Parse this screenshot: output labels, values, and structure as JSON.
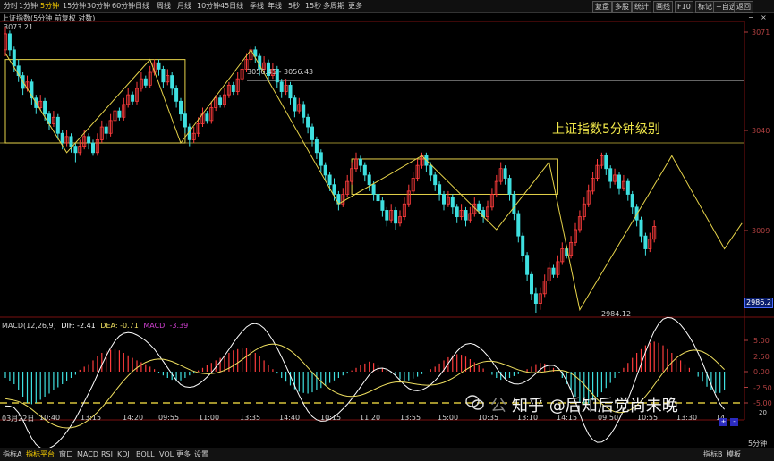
{
  "toolbar": {
    "left_items": [
      "分时",
      "1分钟",
      "5分钟",
      "15分钟",
      "30分钟",
      "60分钟",
      "日线",
      "周线",
      "月线",
      "10分钟",
      "45日线",
      "季线",
      "年线",
      "5秒",
      "15秒",
      "多周期",
      "更多"
    ],
    "active_index": 2,
    "right_items": [
      "复盘",
      "多股",
      "统计",
      "画线",
      "F10",
      "标记",
      "+自选",
      "返回"
    ],
    "top_right_icons": [
      "minimize-icon",
      "close-icon"
    ]
  },
  "subtitle": "上证指数(5分钟 前复权 对数)",
  "price_labels": {
    "high": "3073.21",
    "range": "3056.45 - 3056.43",
    "low": "2984.12",
    "current": "2986.2"
  },
  "y_axis": [
    "3071",
    "3040",
    "3009"
  ],
  "annotation": "上证指数5分钟级别",
  "macd": {
    "name": "MACD(12,26,9)",
    "dif": "DIF: -2.41",
    "dea": "DEA: -0.71",
    "macd": "MACD: -3.39",
    "colors": {
      "dif": "#ffffff",
      "dea": "#f0e060",
      "macd": "#d040d0"
    }
  },
  "macd_axis": [
    "5.00",
    "2.50",
    "0.00",
    "-2.50",
    "-5.00"
  ],
  "x_axis": [
    "03月22日",
    "10:40",
    "13:15",
    "14:20",
    "09:55",
    "11:00",
    "13:35",
    "14:40",
    "10:15",
    "11:20",
    "13:55",
    "15:00",
    "10:35",
    "13:10",
    "14:15",
    "09:50",
    "10:55",
    "13:30",
    "14"
  ],
  "x_axis_right": "20",
  "bottom_tabs": [
    "指标A",
    "指标平台",
    "窗口",
    "MACD",
    "RSI",
    "KDJ",
    "BOLL",
    "VOL",
    "更多",
    "设置"
  ],
  "bottom_active_index": 1,
  "bottom_right": [
    "指标B",
    "模板",
    "5分钟"
  ],
  "watermark": "知乎 @后知后觉尚未晚",
  "watermark_prefix": "公",
  "colors": {
    "up": "#ff3c3c",
    "down": "#3fe0e0",
    "box": "#e6d34a",
    "accent": "#ffd400"
  },
  "chart_data": {
    "type": "candlestick",
    "candles": [
      {
        "o": 3066,
        "c": 3071,
        "h": 3073.2,
        "l": 3064
      },
      {
        "o": 3071,
        "c": 3066,
        "h": 3072,
        "l": 3064
      },
      {
        "o": 3066,
        "c": 3061,
        "h": 3067,
        "l": 3059
      },
      {
        "o": 3061,
        "c": 3058,
        "h": 3063,
        "l": 3056
      },
      {
        "o": 3058,
        "c": 3054,
        "h": 3059,
        "l": 3052
      },
      {
        "o": 3054,
        "c": 3056,
        "h": 3058,
        "l": 3053
      },
      {
        "o": 3056,
        "c": 3051,
        "h": 3057,
        "l": 3049
      },
      {
        "o": 3051,
        "c": 3048,
        "h": 3052,
        "l": 3046
      },
      {
        "o": 3048,
        "c": 3050,
        "h": 3052,
        "l": 3047
      },
      {
        "o": 3050,
        "c": 3046,
        "h": 3051,
        "l": 3044
      },
      {
        "o": 3046,
        "c": 3043,
        "h": 3047,
        "l": 3041
      },
      {
        "o": 3043,
        "c": 3045,
        "h": 3047,
        "l": 3042
      },
      {
        "o": 3045,
        "c": 3040,
        "h": 3046,
        "l": 3038
      },
      {
        "o": 3040,
        "c": 3037,
        "h": 3041,
        "l": 3035
      },
      {
        "o": 3037,
        "c": 3039,
        "h": 3041,
        "l": 3036
      },
      {
        "o": 3039,
        "c": 3036,
        "h": 3040,
        "l": 3034
      },
      {
        "o": 3036,
        "c": 3034,
        "h": 3037,
        "l": 3031
      },
      {
        "o": 3034,
        "c": 3036,
        "h": 3038,
        "l": 3033
      },
      {
        "o": 3036,
        "c": 3039,
        "h": 3041,
        "l": 3035
      },
      {
        "o": 3039,
        "c": 3037,
        "h": 3040,
        "l": 3035
      },
      {
        "o": 3037,
        "c": 3034,
        "h": 3038,
        "l": 3033
      },
      {
        "o": 3034,
        "c": 3038,
        "h": 3040,
        "l": 3033
      },
      {
        "o": 3038,
        "c": 3042,
        "h": 3044,
        "l": 3037
      },
      {
        "o": 3042,
        "c": 3040,
        "h": 3043,
        "l": 3038
      },
      {
        "o": 3040,
        "c": 3044,
        "h": 3046,
        "l": 3039
      },
      {
        "o": 3044,
        "c": 3047,
        "h": 3049,
        "l": 3043
      },
      {
        "o": 3047,
        "c": 3045,
        "h": 3048,
        "l": 3044
      },
      {
        "o": 3045,
        "c": 3049,
        "h": 3051,
        "l": 3044
      },
      {
        "o": 3049,
        "c": 3052,
        "h": 3054,
        "l": 3048
      },
      {
        "o": 3052,
        "c": 3050,
        "h": 3053,
        "l": 3049
      },
      {
        "o": 3050,
        "c": 3054,
        "h": 3056,
        "l": 3049
      },
      {
        "o": 3054,
        "c": 3057,
        "h": 3059,
        "l": 3053
      },
      {
        "o": 3057,
        "c": 3055,
        "h": 3058,
        "l": 3054
      },
      {
        "o": 3055,
        "c": 3059,
        "h": 3061,
        "l": 3054
      },
      {
        "o": 3059,
        "c": 3062,
        "h": 3063,
        "l": 3058
      },
      {
        "o": 3062,
        "c": 3060,
        "h": 3063,
        "l": 3058
      },
      {
        "o": 3060,
        "c": 3056,
        "h": 3061,
        "l": 3054
      },
      {
        "o": 3056,
        "c": 3058,
        "h": 3060,
        "l": 3055
      },
      {
        "o": 3058,
        "c": 3054,
        "h": 3059,
        "l": 3052
      },
      {
        "o": 3054,
        "c": 3050,
        "h": 3055,
        "l": 3048
      },
      {
        "o": 3050,
        "c": 3046,
        "h": 3051,
        "l": 3044
      },
      {
        "o": 3046,
        "c": 3042,
        "h": 3047,
        "l": 3040
      },
      {
        "o": 3042,
        "c": 3038,
        "h": 3043,
        "l": 3036
      },
      {
        "o": 3038,
        "c": 3040,
        "h": 3042,
        "l": 3037
      },
      {
        "o": 3040,
        "c": 3043,
        "h": 3045,
        "l": 3039
      },
      {
        "o": 3043,
        "c": 3046,
        "h": 3048,
        "l": 3042
      },
      {
        "o": 3046,
        "c": 3044,
        "h": 3047,
        "l": 3043
      },
      {
        "o": 3044,
        "c": 3048,
        "h": 3050,
        "l": 3043
      },
      {
        "o": 3048,
        "c": 3051,
        "h": 3052,
        "l": 3047
      },
      {
        "o": 3051,
        "c": 3049,
        "h": 3052,
        "l": 3048
      },
      {
        "o": 3049,
        "c": 3052,
        "h": 3054,
        "l": 3048
      },
      {
        "o": 3052,
        "c": 3055,
        "h": 3056,
        "l": 3051
      },
      {
        "o": 3055,
        "c": 3053,
        "h": 3056,
        "l": 3052
      },
      {
        "o": 3053,
        "c": 3057,
        "h": 3059,
        "l": 3052
      },
      {
        "o": 3057,
        "c": 3060,
        "h": 3062,
        "l": 3056
      },
      {
        "o": 3060,
        "c": 3063,
        "h": 3065,
        "l": 3059
      },
      {
        "o": 3063,
        "c": 3066,
        "h": 3067,
        "l": 3062
      },
      {
        "o": 3066,
        "c": 3064,
        "h": 3067,
        "l": 3062
      },
      {
        "o": 3064,
        "c": 3060,
        "h": 3065,
        "l": 3058
      },
      {
        "o": 3060,
        "c": 3062,
        "h": 3064,
        "l": 3059
      },
      {
        "o": 3062,
        "c": 3058,
        "h": 3063,
        "l": 3056
      },
      {
        "o": 3058,
        "c": 3060,
        "h": 3062,
        "l": 3057
      },
      {
        "o": 3060,
        "c": 3056,
        "h": 3061,
        "l": 3054
      },
      {
        "o": 3056,
        "c": 3053,
        "h": 3057,
        "l": 3051
      },
      {
        "o": 3053,
        "c": 3055,
        "h": 3057,
        "l": 3052
      },
      {
        "o": 3055,
        "c": 3051,
        "h": 3056,
        "l": 3049
      },
      {
        "o": 3051,
        "c": 3047,
        "h": 3052,
        "l": 3045
      },
      {
        "o": 3047,
        "c": 3049,
        "h": 3051,
        "l": 3046
      },
      {
        "o": 3049,
        "c": 3045,
        "h": 3050,
        "l": 3043
      },
      {
        "o": 3045,
        "c": 3042,
        "h": 3046,
        "l": 3040
      },
      {
        "o": 3042,
        "c": 3038,
        "h": 3043,
        "l": 3036
      },
      {
        "o": 3038,
        "c": 3034,
        "h": 3039,
        "l": 3032
      },
      {
        "o": 3034,
        "c": 3030,
        "h": 3035,
        "l": 3028
      },
      {
        "o": 3030,
        "c": 3027,
        "h": 3031,
        "l": 3025
      },
      {
        "o": 3027,
        "c": 3024,
        "h": 3028,
        "l": 3022
      },
      {
        "o": 3024,
        "c": 3021,
        "h": 3026,
        "l": 3019
      },
      {
        "o": 3021,
        "c": 3018,
        "h": 3022,
        "l": 3016
      },
      {
        "o": 3018,
        "c": 3021,
        "h": 3023,
        "l": 3017
      },
      {
        "o": 3021,
        "c": 3025,
        "h": 3027,
        "l": 3020
      },
      {
        "o": 3025,
        "c": 3029,
        "h": 3031,
        "l": 3024
      },
      {
        "o": 3029,
        "c": 3032,
        "h": 3034,
        "l": 3028
      },
      {
        "o": 3032,
        "c": 3030,
        "h": 3033,
        "l": 3028
      },
      {
        "o": 3030,
        "c": 3027,
        "h": 3031,
        "l": 3025
      },
      {
        "o": 3027,
        "c": 3024,
        "h": 3028,
        "l": 3022
      },
      {
        "o": 3024,
        "c": 3021,
        "h": 3025,
        "l": 3019
      },
      {
        "o": 3021,
        "c": 3019,
        "h": 3022,
        "l": 3017
      },
      {
        "o": 3019,
        "c": 3016,
        "h": 3020,
        "l": 3014
      },
      {
        "o": 3016,
        "c": 3013,
        "h": 3017,
        "l": 3011
      },
      {
        "o": 3013,
        "c": 3016,
        "h": 3018,
        "l": 3012
      },
      {
        "o": 3016,
        "c": 3012,
        "h": 3017,
        "l": 3010
      },
      {
        "o": 3012,
        "c": 3014,
        "h": 3016,
        "l": 3011
      },
      {
        "o": 3014,
        "c": 3018,
        "h": 3020,
        "l": 3013
      },
      {
        "o": 3018,
        "c": 3022,
        "h": 3024,
        "l": 3017
      },
      {
        "o": 3022,
        "c": 3026,
        "h": 3028,
        "l": 3021
      },
      {
        "o": 3026,
        "c": 3030,
        "h": 3032,
        "l": 3025
      },
      {
        "o": 3030,
        "c": 3033,
        "h": 3034,
        "l": 3029
      },
      {
        "o": 3033,
        "c": 3030,
        "h": 3034,
        "l": 3028
      },
      {
        "o": 3030,
        "c": 3027,
        "h": 3031,
        "l": 3025
      },
      {
        "o": 3027,
        "c": 3024,
        "h": 3028,
        "l": 3022
      },
      {
        "o": 3024,
        "c": 3021,
        "h": 3025,
        "l": 3019
      },
      {
        "o": 3021,
        "c": 3018,
        "h": 3022,
        "l": 3016
      },
      {
        "o": 3018,
        "c": 3020,
        "h": 3022,
        "l": 3017
      },
      {
        "o": 3020,
        "c": 3017,
        "h": 3021,
        "l": 3015
      },
      {
        "o": 3017,
        "c": 3014,
        "h": 3018,
        "l": 3012
      },
      {
        "o": 3014,
        "c": 3016,
        "h": 3018,
        "l": 3013
      },
      {
        "o": 3016,
        "c": 3013,
        "h": 3017,
        "l": 3011
      },
      {
        "o": 3013,
        "c": 3015,
        "h": 3017,
        "l": 3012
      },
      {
        "o": 3015,
        "c": 3018,
        "h": 3020,
        "l": 3014
      },
      {
        "o": 3018,
        "c": 3016,
        "h": 3019,
        "l": 3015
      },
      {
        "o": 3016,
        "c": 3014,
        "h": 3017,
        "l": 3012
      },
      {
        "o": 3014,
        "c": 3017,
        "h": 3019,
        "l": 3013
      },
      {
        "o": 3017,
        "c": 3021,
        "h": 3023,
        "l": 3016
      },
      {
        "o": 3021,
        "c": 3025,
        "h": 3027,
        "l": 3020
      },
      {
        "o": 3025,
        "c": 3029,
        "h": 3031,
        "l": 3024
      },
      {
        "o": 3029,
        "c": 3026,
        "h": 3030,
        "l": 3024
      },
      {
        "o": 3026,
        "c": 3021,
        "h": 3027,
        "l": 3019
      },
      {
        "o": 3021,
        "c": 3015,
        "h": 3022,
        "l": 3013
      },
      {
        "o": 3015,
        "c": 3008,
        "h": 3016,
        "l": 3006
      },
      {
        "o": 3008,
        "c": 3002,
        "h": 3009,
        "l": 3000
      },
      {
        "o": 3002,
        "c": 2996,
        "h": 3003,
        "l": 2994
      },
      {
        "o": 2996,
        "c": 2990,
        "h": 2997,
        "l": 2988
      },
      {
        "o": 2990,
        "c": 2987,
        "h": 2992,
        "l": 2984.1
      },
      {
        "o": 2987,
        "c": 2990,
        "h": 2992,
        "l": 2985
      },
      {
        "o": 2990,
        "c": 2994,
        "h": 2996,
        "l": 2989
      },
      {
        "o": 2994,
        "c": 2998,
        "h": 3000,
        "l": 2993
      },
      {
        "o": 2998,
        "c": 2996,
        "h": 2999,
        "l": 2995
      },
      {
        "o": 2996,
        "c": 3000,
        "h": 3002,
        "l": 2995
      },
      {
        "o": 3000,
        "c": 3004,
        "h": 3006,
        "l": 2999
      },
      {
        "o": 3004,
        "c": 3002,
        "h": 3005,
        "l": 3001
      },
      {
        "o": 3002,
        "c": 3006,
        "h": 3008,
        "l": 3001
      },
      {
        "o": 3006,
        "c": 3010,
        "h": 3012,
        "l": 3005
      },
      {
        "o": 3010,
        "c": 3014,
        "h": 3016,
        "l": 3009
      },
      {
        "o": 3014,
        "c": 3018,
        "h": 3020,
        "l": 3013
      },
      {
        "o": 3018,
        "c": 3022,
        "h": 3024,
        "l": 3017
      },
      {
        "o": 3022,
        "c": 3026,
        "h": 3028,
        "l": 3021
      },
      {
        "o": 3026,
        "c": 3030,
        "h": 3032,
        "l": 3025
      },
      {
        "o": 3030,
        "c": 3033,
        "h": 3034,
        "l": 3029
      },
      {
        "o": 3033,
        "c": 3029,
        "h": 3034,
        "l": 3027
      },
      {
        "o": 3029,
        "c": 3025,
        "h": 3030,
        "l": 3023
      },
      {
        "o": 3025,
        "c": 3027,
        "h": 3029,
        "l": 3024
      },
      {
        "o": 3027,
        "c": 3023,
        "h": 3028,
        "l": 3021
      },
      {
        "o": 3023,
        "c": 3025,
        "h": 3027,
        "l": 3022
      },
      {
        "o": 3025,
        "c": 3021,
        "h": 3026,
        "l": 3019
      },
      {
        "o": 3021,
        "c": 3017,
        "h": 3022,
        "l": 3015
      },
      {
        "o": 3017,
        "c": 3013,
        "h": 3018,
        "l": 3011
      },
      {
        "o": 3013,
        "c": 3008,
        "h": 3014,
        "l": 3006
      },
      {
        "o": 3008,
        "c": 3004,
        "h": 3009,
        "l": 3002
      },
      {
        "o": 3004,
        "c": 3007,
        "h": 3009,
        "l": 3003
      },
      {
        "o": 3007,
        "c": 3011,
        "h": 3013,
        "l": 3006
      }
    ],
    "zigzag": [
      [
        0,
        3065
      ],
      [
        14,
        3034
      ],
      [
        33,
        3063
      ],
      [
        40,
        3037
      ],
      [
        56,
        3066
      ],
      [
        76,
        3018
      ],
      [
        95,
        3033
      ],
      [
        112,
        3010
      ],
      [
        124,
        3031
      ],
      [
        131,
        2985
      ],
      [
        152,
        3033
      ],
      [
        164,
        3004
      ],
      [
        168,
        3012
      ]
    ],
    "boxes": [
      [
        0,
        41,
        3037,
        3063
      ],
      [
        79,
        126,
        3021,
        3032
      ]
    ],
    "hlines": [
      3056.4,
      3037
    ],
    "macd_hist": [
      -1,
      -1.5,
      -2,
      -3,
      -4,
      -5,
      -5.2,
      -5,
      -4.5,
      -4,
      -3.5,
      -3,
      -2.5,
      -2,
      -1.5,
      -1,
      -0.5,
      0.3,
      0.8,
      1.2,
      1.8,
      2.5,
      3,
      3.3,
      3.5,
      3.6,
      3.4,
      3,
      2.6,
      2.2,
      1.8,
      1.5,
      1.2,
      0.8,
      0.4,
      -0.2,
      -0.6,
      -1,
      -1.3,
      -1.6,
      -1.4,
      -1,
      -0.6,
      -0.3,
      0.2,
      0.6,
      1,
      1.4,
      1.8,
      2.2,
      2.6,
      3,
      3.4,
      3.6,
      3.7,
      3.8,
      3.5,
      3,
      2.5,
      1.8,
      1,
      0.4,
      -0.3,
      -1,
      -1.6,
      -2.2,
      -2.8,
      -3.2,
      -3.4,
      -3.5,
      -3.3,
      -3,
      -2.6,
      -2.2,
      -1.8,
      -1.4,
      -1,
      -0.6,
      -0.3,
      0.2,
      0.6,
      1,
      1.3,
      1.6,
      1.4,
      1,
      0.6,
      0.2,
      -0.3,
      -0.8,
      -1.2,
      -1.5,
      -1.4,
      -1.1,
      -0.8,
      -0.4,
      0,
      0.4,
      0.8,
      1.3,
      1.8,
      2.3,
      2.6,
      2.8,
      2.7,
      2.4,
      2,
      1.5,
      1,
      0.5,
      0,
      -0.5,
      -1,
      -1.3,
      -1.2,
      -1,
      -0.7,
      -0.4,
      0,
      0.4,
      0.8,
      1.2,
      1.4,
      1.3,
      1,
      0.6,
      0,
      -1,
      -2,
      -3,
      -4,
      -4.8,
      -5.2,
      -5.1,
      -4.6,
      -4,
      -3.3,
      -2.6,
      -1.8,
      -1,
      -0.2,
      0.6,
      1.4,
      2.2,
      3,
      3.6,
      4.2,
      4.6,
      4.8,
      4.6,
      4.2,
      3.6,
      3,
      2.4,
      1.8,
      1.2,
      0.6,
      0,
      -0.8,
      -1.6,
      -2.4,
      -3,
      -3.4,
      -3.4,
      -3
    ]
  }
}
